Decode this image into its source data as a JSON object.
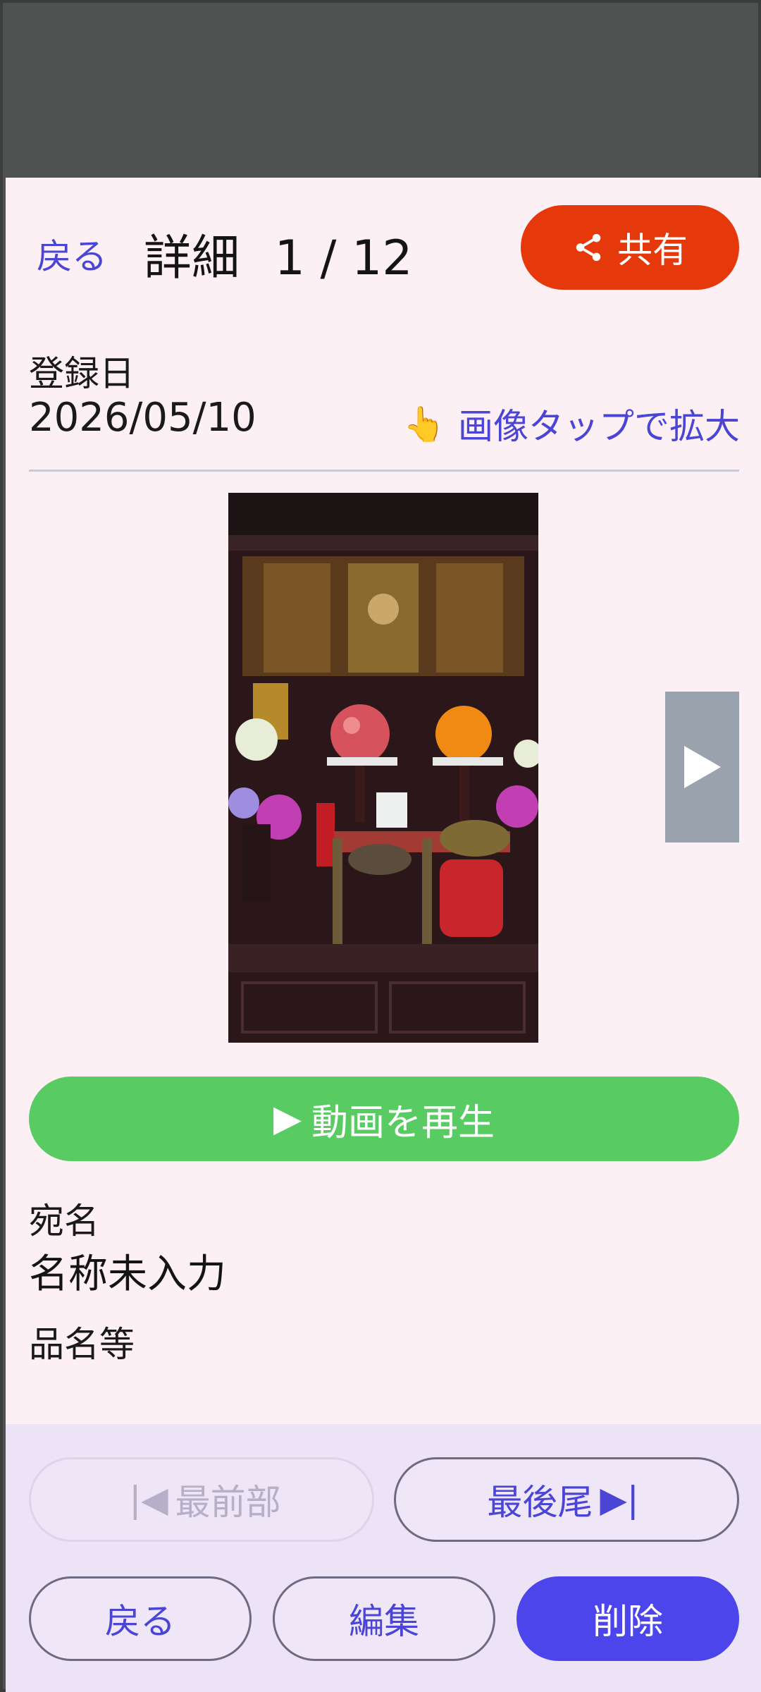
{
  "header": {
    "back_label": "戻る",
    "title": "詳細",
    "page_counter": "1 / 12",
    "share_label": "共有"
  },
  "record": {
    "registration_label": "登録日",
    "registration_date": "2026/05/10",
    "zoom_hint": "画像タップで拡大",
    "zoom_hint_icon": "👆"
  },
  "photo": {
    "subject": "butsudan-altar-photo"
  },
  "video": {
    "play_label": "動画を再生",
    "play_icon": "▶"
  },
  "fields": {
    "recipient_label": "宛名",
    "recipient_value": "名称未入力",
    "item_label": "品名等",
    "item_value": ""
  },
  "footer": {
    "first_label": "最前部",
    "first_glyph": "|◀",
    "last_label": "最後尾",
    "last_glyph": "▶|",
    "back_label": "戻る",
    "edit_label": "編集",
    "delete_label": "削除"
  },
  "colors": {
    "share": "#e5390b",
    "play": "#58cc63",
    "accent": "#4a45d4",
    "delete": "#4c45ec",
    "background": "#fdf0f5",
    "footer": "#ece3f6"
  }
}
